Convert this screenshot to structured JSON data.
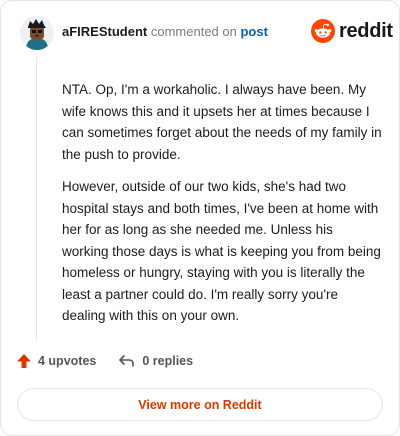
{
  "header": {
    "username": "aFIREStudent",
    "action_text": "commented on",
    "post_link": "post"
  },
  "brand": {
    "icon": "reddit-snoo-icon",
    "name": "reddit",
    "color": "#ff4500"
  },
  "comment": {
    "paragraphs": [
      "NTA. Op, I'm a workaholic. I always have been. My wife knows this and it upsets her at times because I can sometimes forget about the needs of my family in the push to provide.",
      "However, outside of our two kids, she's had two hospital stays and both times, I've been at home with her for as long as she needed me. Unless his working those days is what is keeping you from being homeless or hungry, staying with you is literally the least a partner could do. I'm really sorry you're dealing with this on your own."
    ]
  },
  "actions": {
    "upvotes": "4 upvotes",
    "replies": "0 replies",
    "upvote_icon": "upvote-arrow-icon",
    "reply_icon": "reply-arrow-icon",
    "accent": "#d93a00"
  },
  "footer": {
    "view_more": "View more on Reddit"
  }
}
